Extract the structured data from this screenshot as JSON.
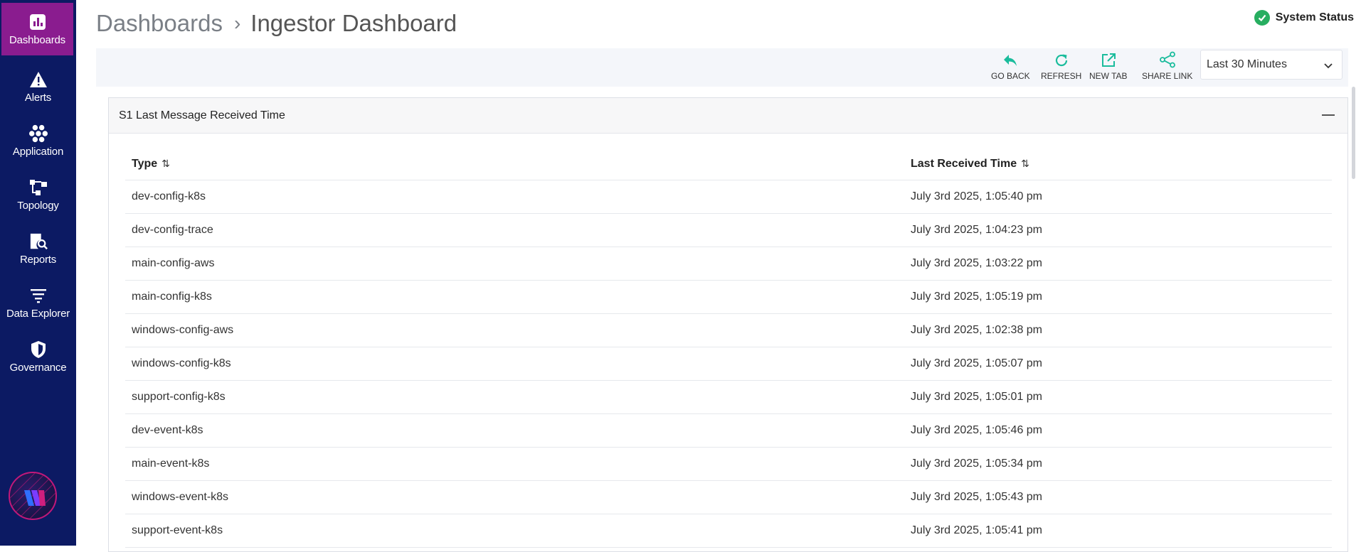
{
  "sidebar": {
    "items": [
      {
        "label": "Dashboards",
        "icon": "bar-chart-icon"
      },
      {
        "label": "Alerts",
        "icon": "warning-icon"
      },
      {
        "label": "Application",
        "icon": "hexagon-cluster-icon"
      },
      {
        "label": "Topology",
        "icon": "topology-icon"
      },
      {
        "label": "Reports",
        "icon": "report-search-icon"
      },
      {
        "label": "Data Explorer",
        "icon": "filter-lines-icon"
      },
      {
        "label": "Governance",
        "icon": "shield-icon"
      }
    ]
  },
  "breadcrumb": {
    "root": "Dashboards",
    "separator": "›",
    "current": "Ingestor Dashboard"
  },
  "system_status": {
    "label": "System Status",
    "state_color": "#27ae60"
  },
  "toolbar": {
    "go_back": "GO BACK",
    "refresh": "REFRESH",
    "new_tab": "NEW TAB",
    "share_link": "SHARE LINK",
    "time_range": "Last 30 Minutes",
    "accent_color": "#1abc9c"
  },
  "panel": {
    "title": "S1 Last Message Received Time",
    "columns": [
      "Type",
      "Last Received Time"
    ],
    "rows": [
      {
        "type": "dev-config-k8s",
        "time": "July 3rd 2025, 1:05:40 pm"
      },
      {
        "type": "dev-config-trace",
        "time": "July 3rd 2025, 1:04:23 pm"
      },
      {
        "type": "main-config-aws",
        "time": "July 3rd 2025, 1:03:22 pm"
      },
      {
        "type": "main-config-k8s",
        "time": "July 3rd 2025, 1:05:19 pm"
      },
      {
        "type": "windows-config-aws",
        "time": "July 3rd 2025, 1:02:38 pm"
      },
      {
        "type": "windows-config-k8s",
        "time": "July 3rd 2025, 1:05:07 pm"
      },
      {
        "type": "support-config-k8s",
        "time": "July 3rd 2025, 1:05:01 pm"
      },
      {
        "type": "dev-event-k8s",
        "time": "July 3rd 2025, 1:05:46 pm"
      },
      {
        "type": "main-event-k8s",
        "time": "July 3rd 2025, 1:05:34 pm"
      },
      {
        "type": "windows-event-k8s",
        "time": "July 3rd 2025, 1:05:43 pm"
      },
      {
        "type": "support-event-k8s",
        "time": "July 3rd 2025, 1:05:41 pm"
      }
    ]
  },
  "colors": {
    "sidebar_bg": "#0c1a63",
    "sidebar_active": "#8a1c8f"
  }
}
